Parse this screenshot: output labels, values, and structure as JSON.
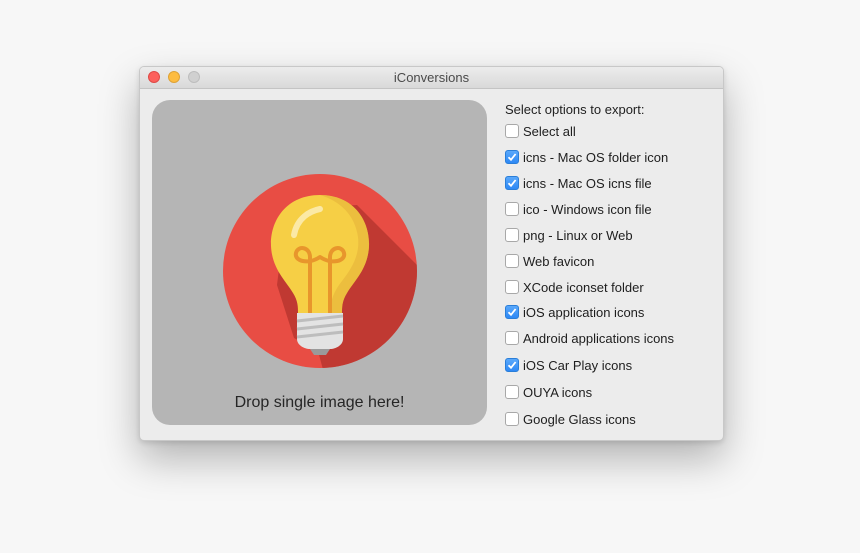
{
  "window": {
    "title": "iConversions",
    "traffic_lights": [
      "close",
      "minimize",
      "zoom"
    ]
  },
  "drop_zone": {
    "label": "Drop single image here!",
    "icon": "lightbulb-icon",
    "colors": {
      "background": "#b5b5b5",
      "circle": "#e84d44",
      "bulb": "#f6cf45",
      "filament": "#e8962c",
      "base": "#e3e3e3"
    }
  },
  "options": {
    "heading": "Select options to export:",
    "items": [
      {
        "label": "Select all",
        "checked": false
      },
      {
        "label": "icns - Mac OS folder icon",
        "checked": true
      },
      {
        "label": "icns - Mac OS icns file",
        "checked": true
      },
      {
        "label": "ico - Windows icon file",
        "checked": false
      },
      {
        "label": "png - Linux or Web",
        "checked": false
      },
      {
        "label": "Web favicon",
        "checked": false
      },
      {
        "label": "XCode iconset folder",
        "checked": false
      },
      {
        "label": "iOS application icons",
        "checked": true
      },
      {
        "label": "Android applications icons",
        "checked": false
      },
      {
        "label": "iOS Car Play icons",
        "checked": true
      },
      {
        "label": "OUYA icons",
        "checked": false
      },
      {
        "label": "Google Glass icons",
        "checked": false
      }
    ],
    "check_color": "#2d88f5"
  }
}
